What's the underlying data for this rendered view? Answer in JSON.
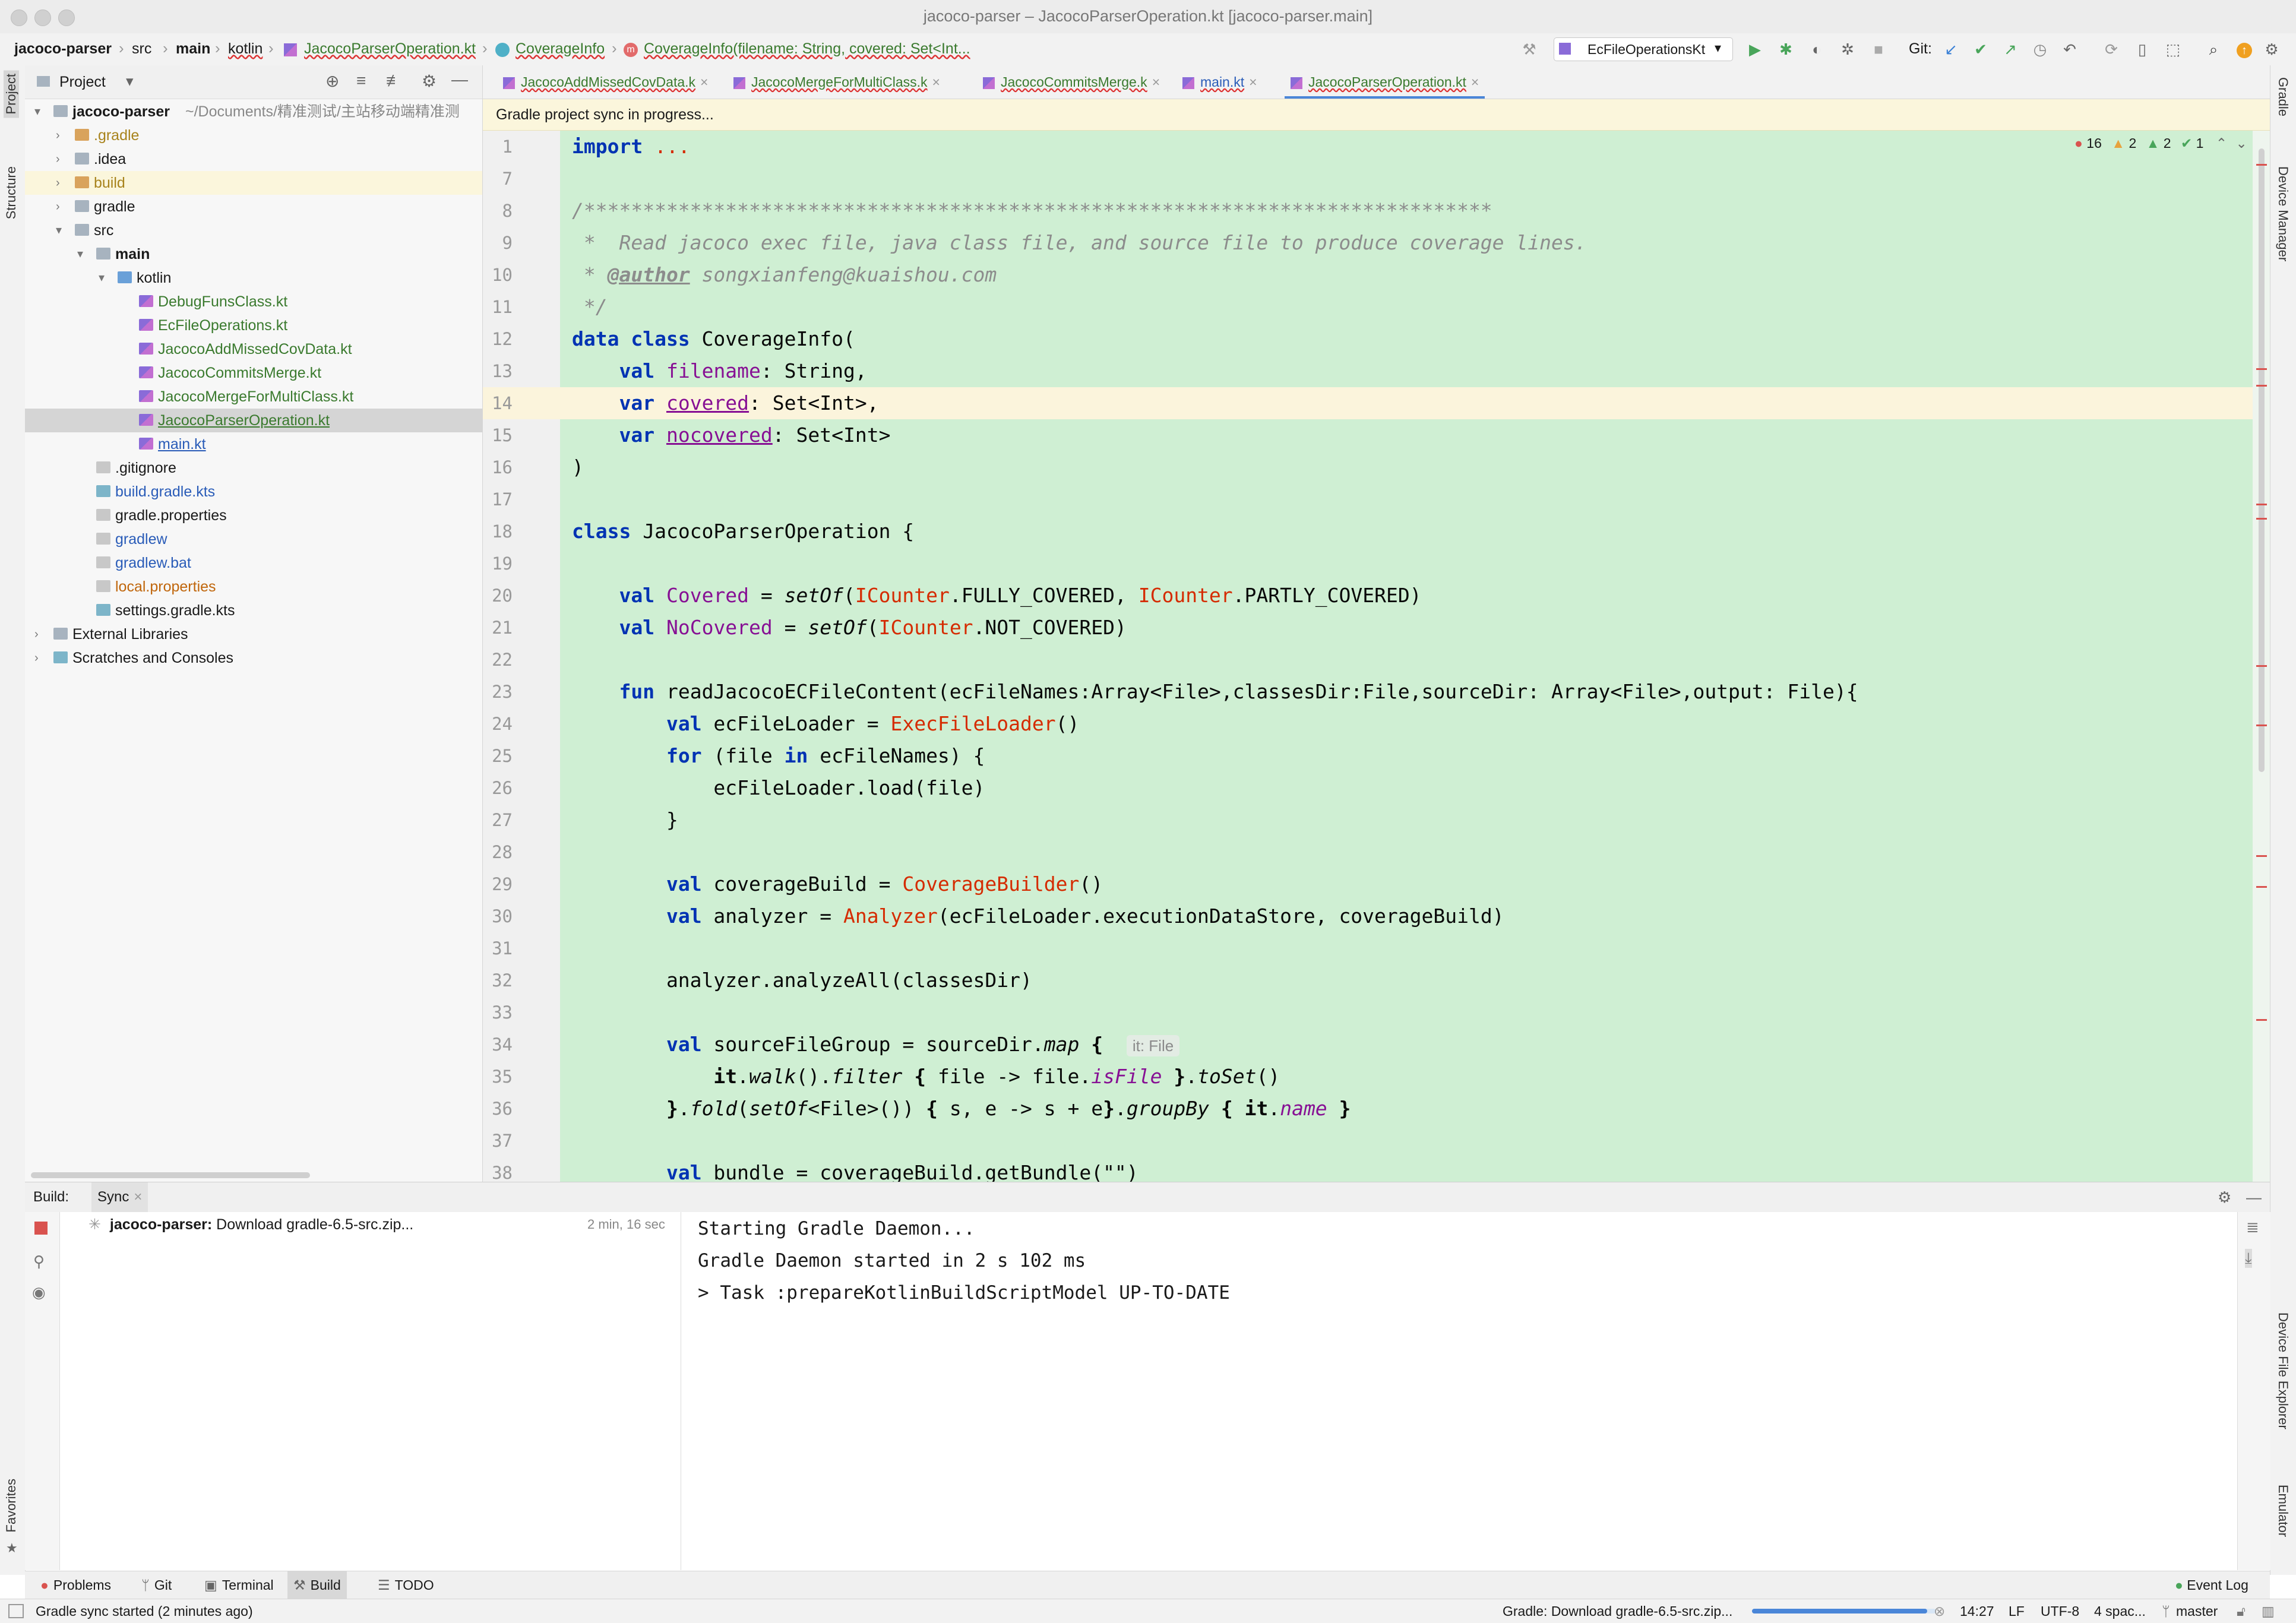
{
  "window": {
    "title": "jacoco-parser – JacocoParserOperation.kt [jacoco-parser.main]"
  },
  "navbar": {
    "breadcrumbs": [
      "jacoco-parser",
      "src",
      "main",
      "kotlin",
      "JacocoParserOperation.kt",
      "CoverageInfo",
      "CoverageInfo(filename: String, covered: Set<Int..."
    ],
    "run_config": "EcFileOperationsKt",
    "git_label": "Git:"
  },
  "left_strip": {
    "project": "Project",
    "structure": "Structure",
    "favorites": "Favorites"
  },
  "right_strip": {
    "gradle": "Gradle",
    "device_manager": "Device Manager",
    "device_file_explorer": "Device File Explorer",
    "emulator": "Emulator"
  },
  "project_pane": {
    "title": "Project",
    "tree": [
      {
        "label": "jacoco-parser",
        "extra": "~/Documents/精准测试/主站移动端精准测",
        "depth": 0,
        "arrow": "▾",
        "icon": "folder",
        "bold": true
      },
      {
        "label": ".gradle",
        "depth": 1,
        "arrow": "›",
        "icon": "folder-orange",
        "color": "#a8831c"
      },
      {
        "label": ".idea",
        "depth": 1,
        "arrow": "›",
        "icon": "folder"
      },
      {
        "label": "build",
        "depth": 1,
        "arrow": "›",
        "icon": "folder-orange",
        "color": "#a8831c",
        "highlight": true
      },
      {
        "label": "gradle",
        "depth": 1,
        "arrow": "›",
        "icon": "folder"
      },
      {
        "label": "src",
        "depth": 1,
        "arrow": "▾",
        "icon": "folder"
      },
      {
        "label": "main",
        "depth": 2,
        "arrow": "▾",
        "icon": "folder",
        "bold": true
      },
      {
        "label": "kotlin",
        "depth": 3,
        "arrow": "▾",
        "icon": "folder-blue"
      },
      {
        "label": "DebugFunsClass.kt",
        "depth": 4,
        "icon": "kt",
        "color": "#3a7a2e"
      },
      {
        "label": "EcFileOperations.kt",
        "depth": 4,
        "icon": "kt",
        "color": "#3a7a2e"
      },
      {
        "label": "JacocoAddMissedCovData.kt",
        "depth": 4,
        "icon": "kt",
        "color": "#3a7a2e"
      },
      {
        "label": "JacocoCommitsMerge.kt",
        "depth": 4,
        "icon": "kt",
        "color": "#3a7a2e"
      },
      {
        "label": "JacocoMergeForMultiClass.kt",
        "depth": 4,
        "icon": "kt",
        "color": "#3a7a2e"
      },
      {
        "label": "JacocoParserOperation.kt",
        "depth": 4,
        "icon": "kt",
        "color": "#3a7a2e",
        "selected": true
      },
      {
        "label": "main.kt",
        "depth": 4,
        "icon": "kt",
        "color": "#2a5cb8"
      },
      {
        "label": ".gitignore",
        "depth": 2,
        "icon": "fileico"
      },
      {
        "label": "build.gradle.kts",
        "depth": 2,
        "icon": "gradleico",
        "color": "#2a5cb8"
      },
      {
        "label": "gradle.properties",
        "depth": 2,
        "icon": "fileico"
      },
      {
        "label": "gradlew",
        "depth": 2,
        "icon": "fileico",
        "color": "#2a5cb8"
      },
      {
        "label": "gradlew.bat",
        "depth": 2,
        "icon": "fileico",
        "color": "#2a5cb8"
      },
      {
        "label": "local.properties",
        "depth": 2,
        "icon": "fileico",
        "color": "#c0660c"
      },
      {
        "label": "settings.gradle.kts",
        "depth": 2,
        "icon": "gradleico"
      },
      {
        "label": "External Libraries",
        "depth": 0,
        "arrow": "›",
        "icon": "folder"
      },
      {
        "label": "Scratches and Consoles",
        "depth": 0,
        "arrow": "›",
        "icon": "gradleico"
      }
    ]
  },
  "tabs": [
    {
      "label": "JacocoAddMissedCovData.k",
      "active": false
    },
    {
      "label": "JacocoMergeForMultiClass.k",
      "active": false
    },
    {
      "label": "JacocoCommitsMerge.k",
      "active": false
    },
    {
      "label": "main.kt",
      "active": false
    },
    {
      "label": "JacocoParserOperation.kt",
      "active": true
    }
  ],
  "banner": "Gradle project sync in progress...",
  "inspections": {
    "errors": "16",
    "warnings": "2",
    "weak_warnings": "2",
    "typos": "1"
  },
  "editor": {
    "lines": [
      {
        "n": "1",
        "html": "<span class=\"kw\">import</span> <span class=\"red\">...</span>"
      },
      {
        "n": "7",
        "html": ""
      },
      {
        "n": "8",
        "html": "<span class=\"cm\">/*****************************************************************************</span>"
      },
      {
        "n": "9",
        "html": "<span class=\"cm\"> *  Read jacoco exec file, java class file, and source file to produce coverage lines.</span>"
      },
      {
        "n": "10",
        "html": "<span class=\"cm\"> * <span class=\"ul\" style=\"font-weight:bold\">@author</span> songxianfeng@kuaishou.com</span>"
      },
      {
        "n": "11",
        "html": "<span class=\"cm\"> */</span>"
      },
      {
        "n": "12",
        "html": "<span class=\"kw\">data class</span> CoverageInfo("
      },
      {
        "n": "13",
        "html": "    <span class=\"kw\">val</span> <span class=\"prop\">filename</span>: String,"
      },
      {
        "n": "14",
        "html": "    <span class=\"kw\">var</span> <span class=\"prop ul\">covered</span>: Set&lt;Int&gt;,",
        "current": true
      },
      {
        "n": "15",
        "html": "    <span class=\"kw\">var</span> <span class=\"prop ul\">nocovered</span>: Set&lt;Int&gt;"
      },
      {
        "n": "16",
        "html": ")"
      },
      {
        "n": "17",
        "html": ""
      },
      {
        "n": "18",
        "html": "<span class=\"kw\">class</span> JacocoParserOperation {"
      },
      {
        "n": "19",
        "html": ""
      },
      {
        "n": "20",
        "html": "    <span class=\"kw\">val</span> <span class=\"prop\">Covered</span> = <span class=\"it\">setOf</span>(<span class=\"red\">ICounter</span>.FULLY_COVERED, <span class=\"red\">ICounter</span>.PARTLY_COVERED)"
      },
      {
        "n": "21",
        "html": "    <span class=\"kw\">val</span> <span class=\"prop\">NoCovered</span> = <span class=\"it\">setOf</span>(<span class=\"red\">ICounter</span>.NOT_COVERED)"
      },
      {
        "n": "22",
        "html": ""
      },
      {
        "n": "23",
        "html": "    <span class=\"kw\">fun</span> readJacocoECFileContent(ecFileNames:Array&lt;File&gt;,classesDir:File,sourceDir: Array&lt;File&gt;,output: File){"
      },
      {
        "n": "24",
        "html": "        <span class=\"kw\">val</span> ecFileLoader = <span class=\"red\">ExecFileLoader</span>()"
      },
      {
        "n": "25",
        "html": "        <span class=\"kw\">for</span> (file <span class=\"kw\">in</span> ecFileNames) {"
      },
      {
        "n": "26",
        "html": "            ecFileLoader.load(file)"
      },
      {
        "n": "27",
        "html": "        }"
      },
      {
        "n": "28",
        "html": ""
      },
      {
        "n": "29",
        "html": "        <span class=\"kw\">val</span> coverageBuild = <span class=\"red\">CoverageBuilder</span>()"
      },
      {
        "n": "30",
        "html": "        <span class=\"kw\">val</span> analyzer = <span class=\"red\">Analyzer</span>(ecFileLoader.executionDataStore, coverageBuild)"
      },
      {
        "n": "31",
        "html": ""
      },
      {
        "n": "32",
        "html": "        analyzer.analyzeAll(classesDir)"
      },
      {
        "n": "33",
        "html": ""
      },
      {
        "n": "34",
        "html": "        <span class=\"kw\">val</span> sourceFileGroup = sourceDir.<span class=\"it\">map</span> <b>{</b>  <span class=\"hint\">it: File</span>"
      },
      {
        "n": "35",
        "html": "            <b>it</b>.<span class=\"it\">walk</span>().<span class=\"it\">filter</span> <b>{</b> file -&gt; file.<span class=\"prop it\">isFile</span> <b>}</b>.<span class=\"it\">toSet</span>()"
      },
      {
        "n": "36",
        "html": "        <b>}</b>.<span class=\"it\">fold</span>(<span class=\"it\">setOf</span>&lt;File&gt;()) <b>{</b> s, e -&gt; s + e<b>}</b>.<span class=\"it\">groupBy</span> <b>{</b> <b>it</b>.<span class=\"prop it\">name</span> <b>}</b>"
      },
      {
        "n": "37",
        "html": ""
      },
      {
        "n": "38",
        "html": "        <span class=\"kw\">val</span> bundle = coverageBuild.getBundle(\"\")"
      }
    ]
  },
  "build": {
    "label": "Build:",
    "tab": "Sync",
    "task_name": "jacoco-parser:",
    "task_desc": "Download gradle-6.5-src.zip...",
    "task_time": "2 min, 16 sec",
    "log": [
      "Starting Gradle Daemon...",
      "Gradle Daemon started in 2 s 102 ms",
      "> Task :prepareKotlinBuildScriptModel UP-TO-DATE"
    ]
  },
  "bottom_tabs": [
    {
      "label": "Problems",
      "icon": "problems-icon"
    },
    {
      "label": "Git",
      "icon": "git-icon"
    },
    {
      "label": "Terminal",
      "icon": "terminal-icon"
    },
    {
      "label": "Build",
      "icon": "build-icon",
      "active": true
    },
    {
      "label": "TODO",
      "icon": "todo-icon"
    }
  ],
  "event_log": "Event Log",
  "status": {
    "message": "Gradle sync started (2 minutes ago)",
    "progress_text": "Gradle: Download gradle-6.5-src.zip...",
    "progress": 0.95,
    "position": "14:27",
    "line_sep": "LF",
    "encoding": "UTF-8",
    "indent": "4 spac...",
    "branch": "master"
  },
  "colors": {
    "code_bg": "#cfefd3",
    "current_line": "#fbf4dc",
    "keyword": "#0033b3",
    "error": "#d52b00",
    "accent": "#4a86d8"
  }
}
